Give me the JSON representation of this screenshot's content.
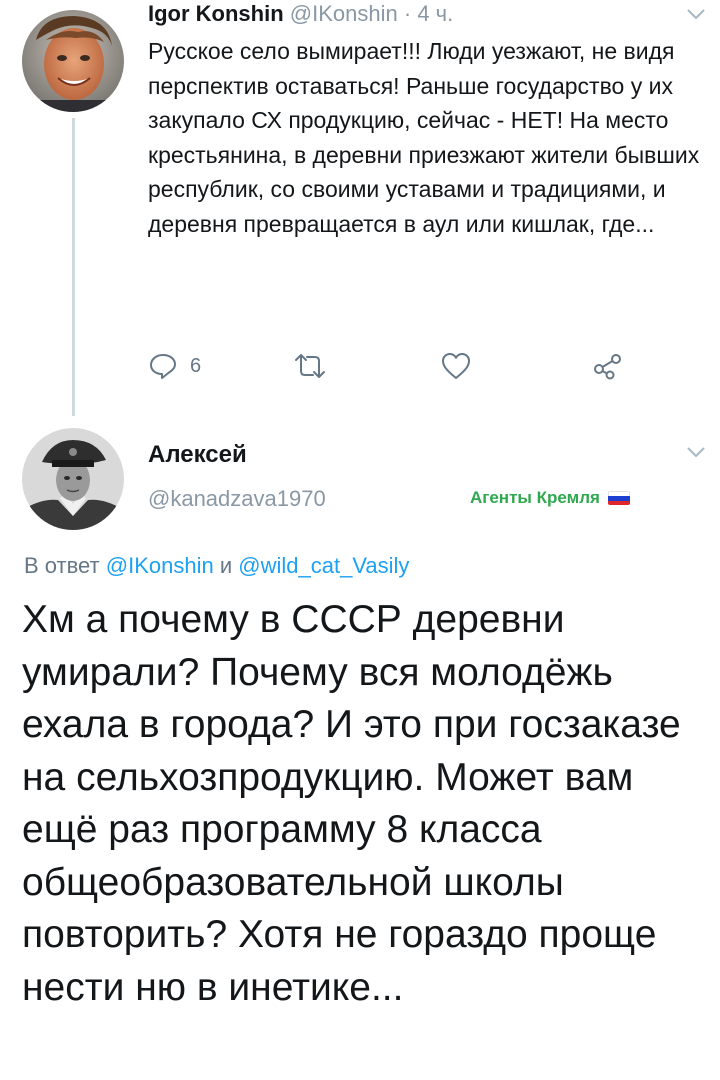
{
  "first_tweet": {
    "author_name": "Igor Konshin",
    "author_handle": "@IKonshin",
    "separator": "·",
    "time": "4 ч.",
    "text": "Русское село вымирает!!! Люди уезжают, не видя перспектив оставаться! Раньше государство у их закупало СХ продукцию, сейчас - НЕТ! На место крестьянина, в деревни приезжают жители бывших республик, со своими уставами и традициями, и деревня превращается в аул или кишлак, где...",
    "reply_count": "6",
    "icons": {
      "reply": "reply-icon",
      "retweet": "retweet-icon",
      "like": "heart-icon",
      "share": "share-icon",
      "menu": "chevron-down-icon"
    }
  },
  "second_tweet": {
    "author_name": "Алексей",
    "author_handle": "@kanadzava1970",
    "badge_label": "Агенты Кремля",
    "badge_flag_colors": [
      "#ffffff",
      "#1c3fd0",
      "#e0262d"
    ],
    "reply_prefix": "В ответ",
    "reply_mention_1": "@IKonshin",
    "reply_conjunction": "и",
    "reply_mention_2": "@wild_cat_Vasily",
    "text": "Хм а почему в СССР деревни умирали? Почему вся молодёжь ехала в города? И это при госзаказе на сельхозпродукцию. Может вам ещё раз программу 8 класса общеобразовательной школы повторить? Хотя не гораздо проще нести ню в инетике..."
  },
  "colors": {
    "text": "#14171a",
    "muted": "#8a98a5",
    "link": "#1da1f2",
    "badge": "#2fa84f",
    "thread_line": "#cfd9de"
  }
}
